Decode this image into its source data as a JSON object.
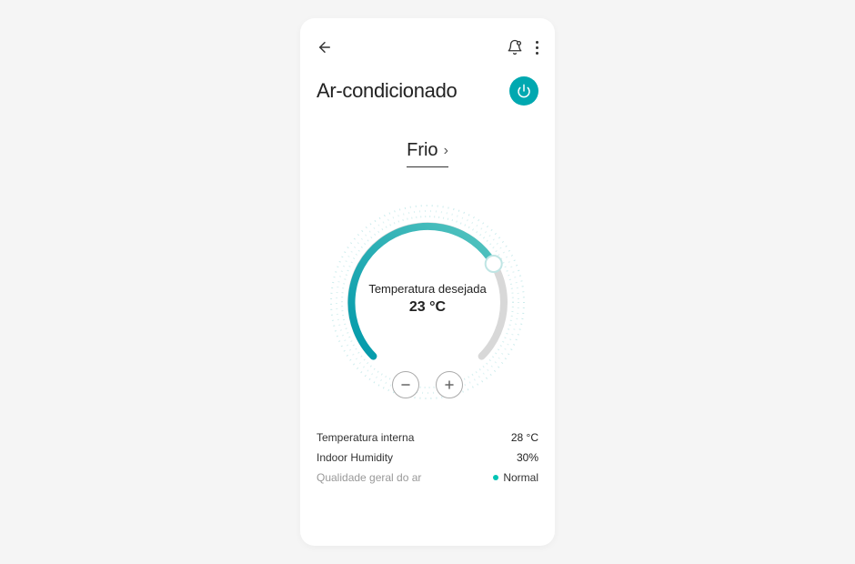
{
  "header": {
    "title": "Ar-condicionado"
  },
  "mode": {
    "label": "Frio"
  },
  "temperature": {
    "label": "Temperatura desejada",
    "value": "23 °C"
  },
  "stats": {
    "indoor_temp_label": "Temperatura interna",
    "indoor_temp_value": "28 °C",
    "humidity_label": "Indoor Humidity",
    "humidity_value": "30%",
    "air_quality_label": "Qualidade geral do ar",
    "air_quality_value": "Normal"
  },
  "colors": {
    "accent": "#00a8b0",
    "air_quality_dot": "#00c4b4"
  }
}
